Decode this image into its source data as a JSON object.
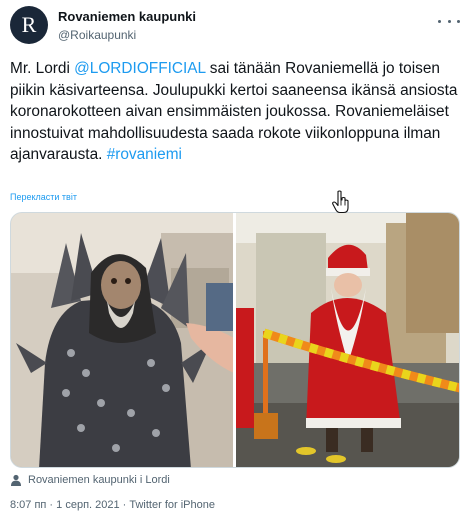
{
  "header": {
    "display_name": "Rovaniemen kaupunki",
    "handle": "@Roikaupunki",
    "avatar_letter": "R",
    "avatar_color": "#1a2738"
  },
  "tweet": {
    "text_part1": "Mr. Lordi ",
    "mention": "@LORDIOFFICIAL",
    "text_part2": " sai tänään Rovaniemellä jo toisen piikin käsivarteensa. Joulupukki kertoi saaneensa ikänsä ansiosta koronarokotteen aivan ensimmäisten joukossa. Rovaniemeläiset innostuivat mahdollisuudesta saada rokote viikonloppuna ilman ajanvarausta. ",
    "hashtag": "#rovaniemi",
    "translate_label": "Перекласти твіт"
  },
  "media": {
    "left_photo": "Mr. Lordi in costume receiving vaccine",
    "right_photo": "Santa Claus behind barrier tape"
  },
  "tagged": {
    "icon": "person-icon",
    "text": "Rovaniemen kaupunki i Lordi"
  },
  "meta": {
    "text": "8:07 пп · 1 серп. 2021 · Twitter for iPhone"
  },
  "colors": {
    "link": "#1d9bf0",
    "secondary_text": "#536471",
    "primary_text": "#0f1419"
  }
}
